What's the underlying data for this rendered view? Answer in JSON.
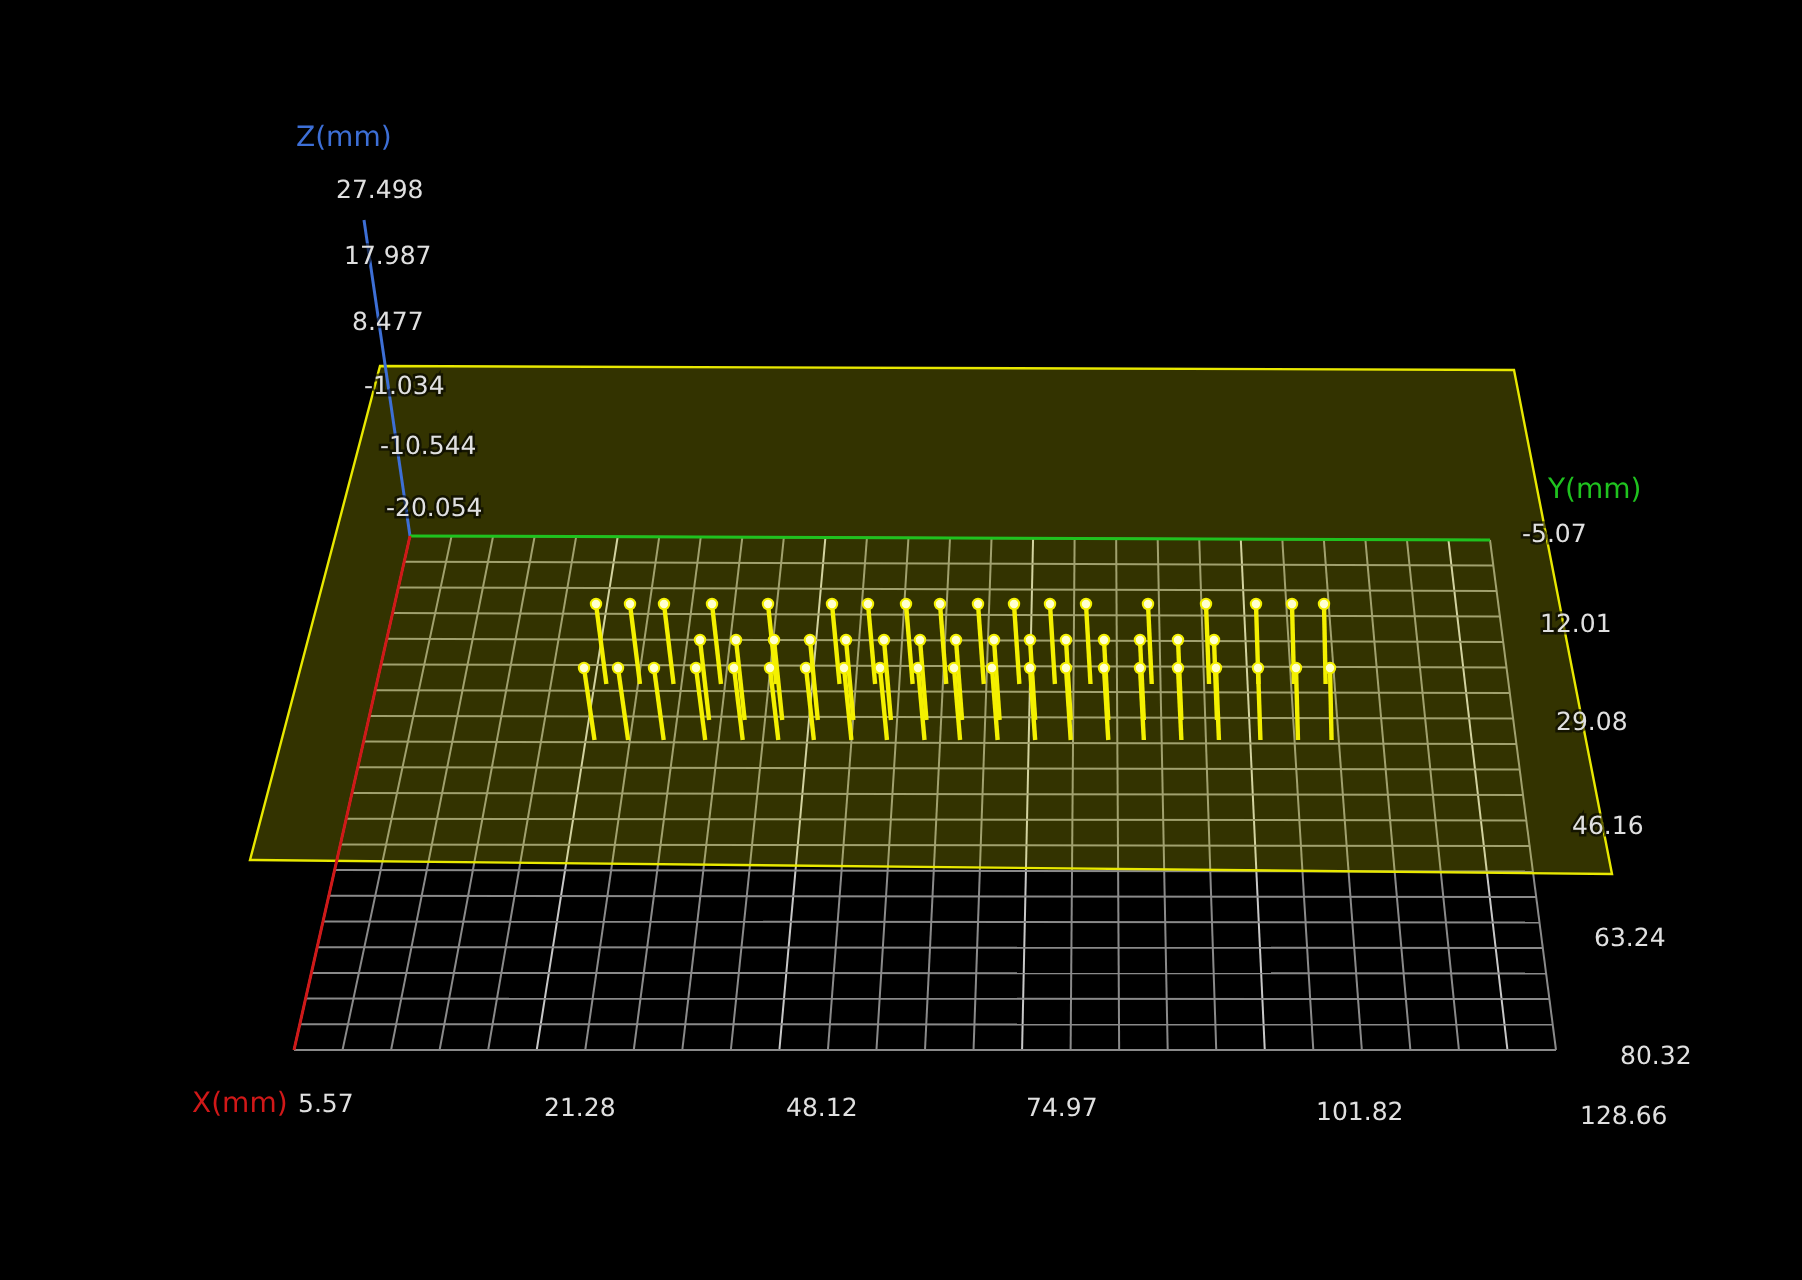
{
  "view": {
    "axes": [
      {
        "kind": "z",
        "title": "Z(mm)",
        "color": "#3d6fd6",
        "ticks": [
          "27.498",
          "17.987",
          "8.477",
          "-1.034",
          "-10.544",
          "-20.054"
        ]
      },
      {
        "kind": "y",
        "title": "Y(mm)",
        "color": "#1fc21f",
        "ticks": [
          "-5.07",
          "12.01",
          "29.08",
          "46.16",
          "63.24",
          "80.32"
        ]
      },
      {
        "kind": "x",
        "title": "X(mm)",
        "color": "#d01818",
        "ticks": [
          "5.57",
          "21.28",
          "48.12",
          "74.97",
          "101.82",
          "128.66"
        ]
      }
    ]
  }
}
